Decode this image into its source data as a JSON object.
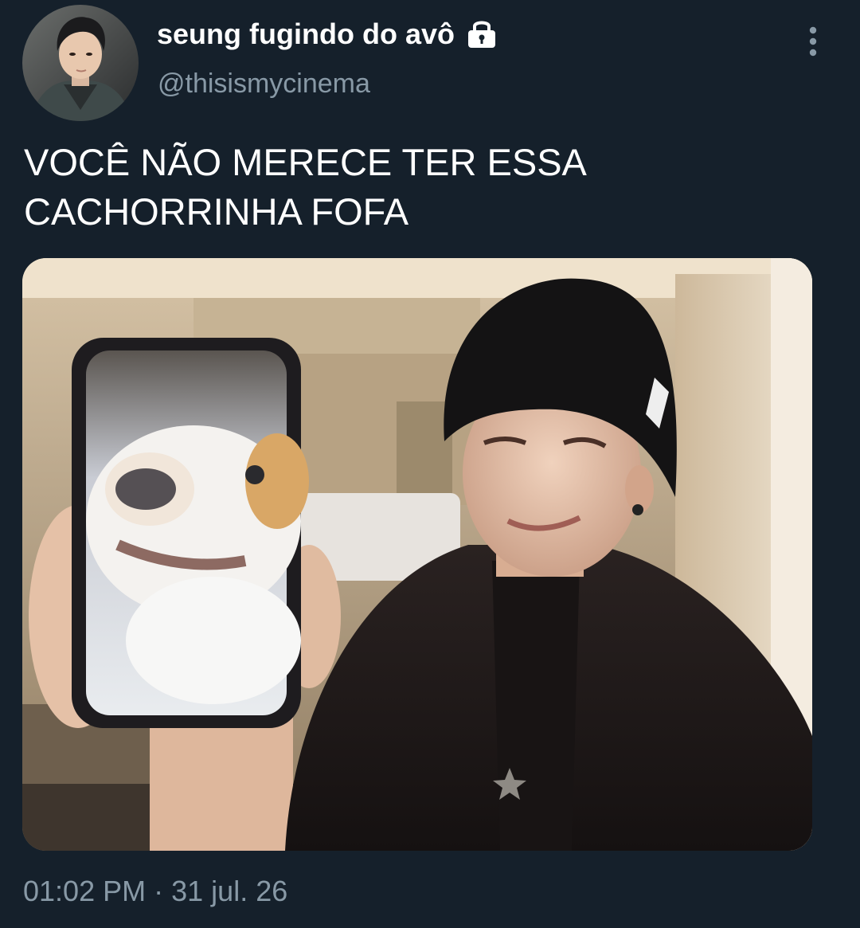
{
  "author": {
    "display_name": "seung fugindo do avô",
    "handle": "@thisismycinema",
    "protected": true
  },
  "tweet": {
    "text": "VOCÊ NÃO MERECE TER ESSA\nCACHORRINHA FOFA",
    "time": "01:02 PM",
    "separator": "·",
    "date": "31 jul. 26"
  },
  "icons": {
    "lock": "lock-icon",
    "more": "more-vertical-icon"
  },
  "colors": {
    "background": "#15202b",
    "secondary_text": "#8899a6",
    "primary_text": "#ffffff"
  }
}
